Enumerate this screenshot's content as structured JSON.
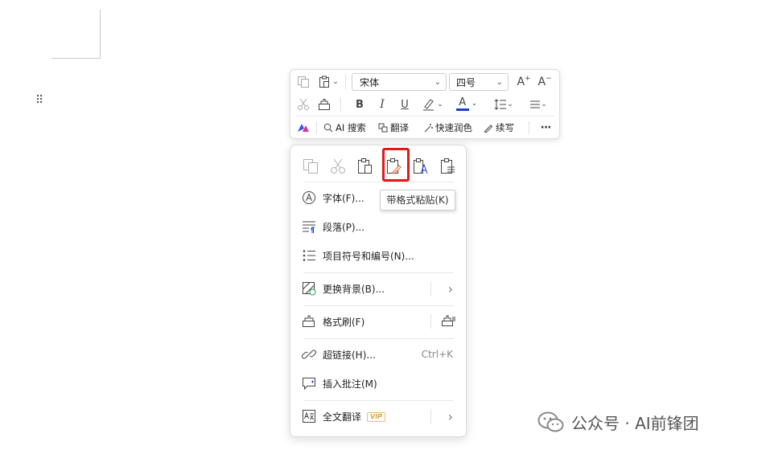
{
  "toolbar": {
    "font_name": "宋体",
    "font_size": "四号",
    "grow_font_label": "A",
    "shrink_font_label": "A",
    "bold_label": "B",
    "italic_label": "I",
    "underline_label": "U",
    "font_color_label": "A",
    "font_color": "#1a3cd8",
    "ai_search_label": "AI 搜索",
    "translate_label": "翻译",
    "polish_label": "快速润色",
    "continue_write_label": "续写",
    "more_label": "···"
  },
  "context_menu": {
    "paste_options": [
      {
        "name": "copy",
        "icon": "copy-icon"
      },
      {
        "name": "cut",
        "icon": "scissors-icon"
      },
      {
        "name": "paste",
        "icon": "clipboard-icon"
      },
      {
        "name": "paste-keep-format",
        "icon": "clipboard-brush-icon"
      },
      {
        "name": "paste-text-only",
        "icon": "clipboard-a-icon"
      },
      {
        "name": "paste-special",
        "icon": "clipboard-list-icon"
      }
    ],
    "items": [
      {
        "label": "字体(F)...",
        "icon": "font-circle-icon"
      },
      {
        "label": "段落(P)...",
        "icon": "paragraph-icon"
      },
      {
        "label": "项目符号和编号(N)...",
        "icon": "bullet-list-icon"
      },
      {
        "label": "更换背景(B)...",
        "icon": "background-icon",
        "submenu_arrow": "›"
      },
      {
        "label": "格式刷(F)",
        "icon": "format-painter-icon"
      },
      {
        "label": "超链接(H)...",
        "icon": "link-icon",
        "shortcut": "Ctrl+K"
      },
      {
        "label": "插入批注(M)",
        "icon": "comment-icon"
      },
      {
        "label": "全文翻译",
        "icon": "translate-doc-icon",
        "badge": "VIP",
        "submenu_arrow": "›"
      }
    ]
  },
  "tooltip": {
    "text": "带格式粘贴(K)"
  },
  "watermark": {
    "text": "公众号 · AI前锋团"
  },
  "colors": {
    "highlight_border": "#e5171a",
    "accent_blue": "#1a3cd8"
  }
}
